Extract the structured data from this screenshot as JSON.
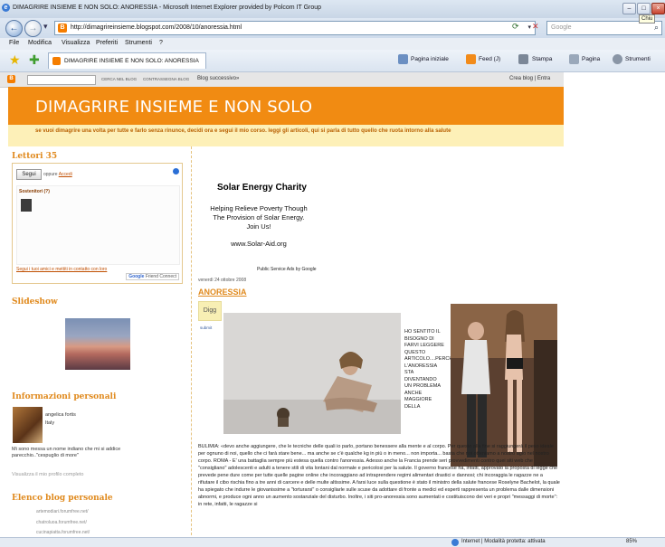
{
  "window": {
    "title": "DIMAGRIRE INSIEME E NON SOLO: ANORESSIA - Microsoft Internet Explorer provided by Polcom IT Group",
    "tooltip": "Chiu"
  },
  "address": {
    "url": "http://dimagrireinsieme.blogspot.com/2008/10/anoressia.html",
    "search_placeholder": "Google"
  },
  "menu": [
    "File",
    "Modifica",
    "Visualizza",
    "Preferiti",
    "Strumenti",
    "?"
  ],
  "favbar": {
    "tab_label": "DIMAGRIRE INSIEME E NON SOLO: ANORESSIA",
    "commands": [
      "Pagina iniziale",
      "Feed (J)",
      "Stampa",
      "Pagina",
      "Strumenti"
    ]
  },
  "navbar": {
    "search_blog": "CERCA NEL BLOG",
    "flag_blog": "CONTRASSEGNA BLOG",
    "next_blog": "Blog successivo»",
    "right": "Crea blog | Entra"
  },
  "blog": {
    "title": "DIMAGRIRE INSIEME E NON SOLO",
    "description": "se vuoi dimagrire una volta per tutte e farlo senza rinunce, decidi ora e segui il mio corso. leggi gli articoli, qui si parla di tutto quello che ruota intorno alla salute"
  },
  "sidebar": {
    "followers_title": "Lettori 35",
    "follow_button": "Segui",
    "sign_in_prefix": "oppure",
    "sign_in_link": "Accedi",
    "followers_label": "Sostenitori (?)",
    "join_link": "Segui i tuoi amici e mettiti in contatto con loro",
    "gfc_label": "Google",
    "gfc_sub": "Friend Connect",
    "slideshow_title": "Slideshow",
    "personal_title": "Informazioni personali",
    "profile_name": "angelica fortis",
    "profile_country": "Italy",
    "profile_bio": "Mi sono messa un nome indiano che mi si addice parecchio..\"cespuglio di more\"",
    "profile_link": "Visualizza il mio profilo completo",
    "blogs_title": "Elenco blog personale",
    "blogs": [
      "artemodiari.forumfree.net/",
      "chatroluoa.forumfree.net/",
      "cucinapiatta.forumfree.net/"
    ]
  },
  "ad": {
    "title": "Solar Energy Charity",
    "lines": [
      "Helping Relieve Poverty Though",
      "The Provision of Solar Energy.",
      "Join Us!"
    ],
    "url": "www.Solar-Aid.org",
    "footer": "Public Service Ads by Google"
  },
  "post": {
    "date": "venerdì 24 ottobre 2008",
    "title": "ANORESSIA",
    "digg": "Digg",
    "submit": "submit",
    "side_text": "HO SENTITO IL BISOGNO DI FARVI LEGGERE QUESTO ARTICOLO....PERCHE' L'ANORESSIA STA DIVENTANDO UN PROBLEMA ANCHE MAGGIORE DELLA",
    "body": "BULIMIA: «devo anche aggiungere, che le tecniche delle quali io parlo, portano benessere alla mente e al corpo. Per questo alla fine si raggiungerà il peso ideale per ognuno di noi, quello che ci farà stare bene... ma anche se c'è qualche kg in più o in meno... non importa... basta che noi otteniamo a nostro agio nel nostro corpo. ROMA - E' una battaglia sempre più estesa quella contro l'anoressia. Adesso anche la Francia prende seri provvedimenti contro quei siti web che \"consigliano\" adolescenti e adulti a tenere stili di vita lontani dal normale e pericolosi per la salute. Il governo francese ha, infatti, approvato la proposta di legge che prevede pene dure come per tutte quelle pagine online che incoraggiano ad intraprendere regimi alimentari drastici e dannosi; chi incoraggia le ragazze ne a rifiutare il cibo rischia fino a tre anni di carcere e delle multe altissime. A farsi luce sulla questione è stato il ministro della salute francese Roselyne Bachelot, la quale ha spiegato che indurre le giovanissime a \"torturarsi\" o consigliarle sulle scuse da adottare di fronte a medici ed esperti rappresenta un problema dalle dimensioni abnormi, e produce ogni anno un aumento sostanziale del disturbo. Inoltre, i siti pro-anoressia sono aumentati e costituiscono dei veri e propri \"messaggi di morte\": in rete, infatti, le ragazze si"
  },
  "statusbar": {
    "zone": "Internet | Modalità protetta: attivata",
    "zoom": "85%"
  }
}
